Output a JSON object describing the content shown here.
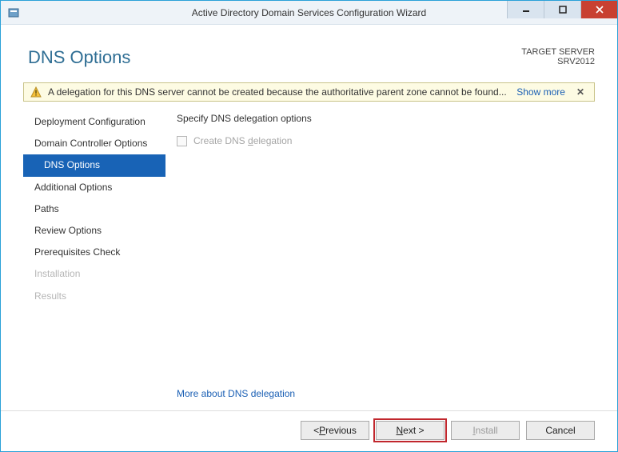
{
  "window": {
    "title": "Active Directory Domain Services Configuration Wizard"
  },
  "header": {
    "page_title": "DNS Options",
    "target_label": "TARGET SERVER",
    "target_server": "SRV2012"
  },
  "warning": {
    "text": "A delegation for this DNS server cannot be created because the authoritative parent zone cannot be found...",
    "show_more": "Show more",
    "close": "✕"
  },
  "sidebar": {
    "items": [
      {
        "label": "Deployment Configuration",
        "state": "normal"
      },
      {
        "label": "Domain Controller Options",
        "state": "normal"
      },
      {
        "label": "DNS Options",
        "state": "selected"
      },
      {
        "label": "Additional Options",
        "state": "normal"
      },
      {
        "label": "Paths",
        "state": "normal"
      },
      {
        "label": "Review Options",
        "state": "normal"
      },
      {
        "label": "Prerequisites Check",
        "state": "normal"
      },
      {
        "label": "Installation",
        "state": "disabled"
      },
      {
        "label": "Results",
        "state": "disabled"
      }
    ]
  },
  "content": {
    "instruction": "Specify DNS delegation options",
    "checkbox_label": "Create DNS delegation",
    "checkbox_checked": false,
    "checkbox_enabled": false,
    "more_link": "More about DNS delegation"
  },
  "footer": {
    "previous": "< Previous",
    "next": "Next >",
    "install": "Install",
    "cancel": "Cancel"
  }
}
